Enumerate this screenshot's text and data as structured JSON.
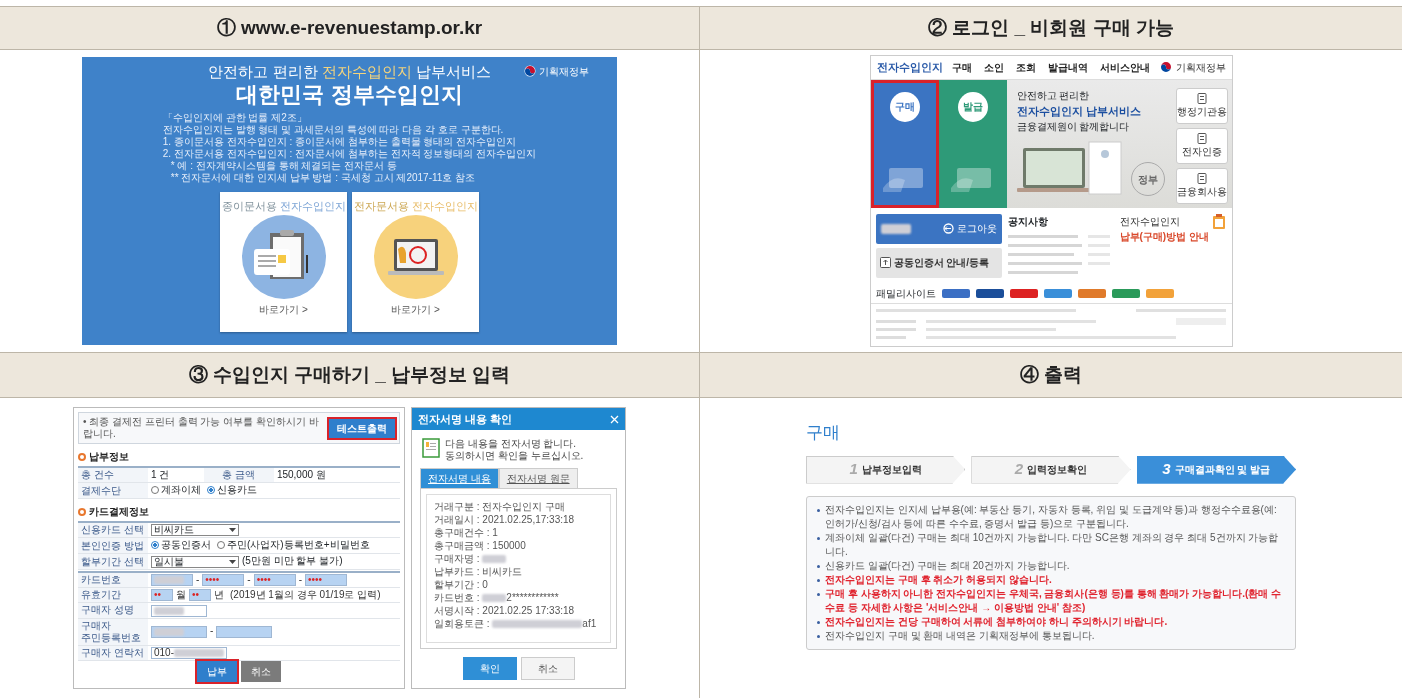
{
  "sections": [
    {
      "kind": "home",
      "heading": "① www.e-revenuestamp.or.kr",
      "screen": {
        "ministry": "기획재정부",
        "headline": {
          "lead": "안전하고 편리한",
          "accent": "전자수입인지",
          "tail": "납부서비스"
        },
        "title": "대한민국 정부수입인지",
        "law_lines": [
          {
            "text": "「수입인지에 관한 법률 제2조」",
            "indented": false
          },
          {
            "text": "전자수입인지는 발행 형태 및 과세문서의 특성에 따라 다음 각 호로 구분한다.",
            "indented": false
          },
          {
            "text": "1. 종이문서용 전자수입인지 : 종이문서에 첨부하는 출력물 형태의 전자수입인지",
            "indented": false
          },
          {
            "text": "2. 전자문서용 전자수입인지 : 전자문서에 첨부하는 전자적 정보형태의 전자수입인지",
            "indented": false
          },
          {
            "text": "* 예 : 전자계약시스템을 통해 체결되는 전자문서 등",
            "indented": true
          },
          {
            "text": "** 전자문서에 대한 인지세 납부 방법 : 국세청 고시 제2017-11호 참조",
            "indented": true
          }
        ],
        "cards": [
          {
            "color": "#8db4e2",
            "accent": "종이문서용",
            "name": "전자수입인지",
            "link": "바로가기 >"
          },
          {
            "color": "#f7d27c",
            "accent": "전자문서용",
            "name": "전자수입인지",
            "link": "바로가기 >"
          }
        ]
      }
    },
    {
      "kind": "portal",
      "heading": "② 로그인 _ 비회원 구매 가능",
      "screen": {
        "logo": "전자수입인지",
        "menu": [
          "구매",
          "소인",
          "조회",
          "발급내역",
          "서비스안내"
        ],
        "ministry": "기획재정부",
        "tiles": [
          {
            "label": "구매",
            "color": "#3b74c2",
            "highlighted": true
          },
          {
            "label": "발급",
            "color": "#2e9a78",
            "highlighted": false
          }
        ],
        "hero": [
          "안전하고 편리한",
          "전자수입인지 납부서비스",
          "금융결제원이 함께합니다"
        ],
        "seal": "정부",
        "quick_links": [
          "행정기관용",
          "전자인증",
          "금융회사용"
        ],
        "logout": "로그아웃",
        "cert": "공동인증서 안내/등록",
        "notice_title": "공지사항",
        "guide_lines": [
          "전자수입인지",
          "납부(구매)방법 안내"
        ],
        "family_site": "패밀리사이트"
      }
    },
    {
      "kind": "payment",
      "heading": "③ 수입인지 구매하기 _ 납부정보 입력",
      "form": {
        "notice": "• 최종 결제전 프린터 출력 가능 여부를 확인하시기 바랍니다.",
        "test_button": {
          "label": "테스트출력",
          "highlighted": true
        },
        "groups": [
          {
            "title": "납부정보",
            "rows": [
              {
                "kind": "pair",
                "label": "총 건수",
                "value": "1 건",
                "label_2": "총 금액",
                "value_2": "150,000 원"
              },
              {
                "kind": "radio",
                "label": "결제수단",
                "options": [
                  {
                    "label": "계좌이체",
                    "selected": false
                  },
                  {
                    "label": "신용카드",
                    "selected": true
                  }
                ]
              }
            ]
          },
          {
            "title": "카드결제정보",
            "rows": [
              {
                "kind": "select",
                "label": "신용카드 선택",
                "value": "비씨카드"
              },
              {
                "kind": "radio",
                "label": "본인인증 방법",
                "options": [
                  {
                    "label": "공동인증서",
                    "selected": true
                  },
                  {
                    "label": "주민(사업자)등록번호+비밀번호",
                    "selected": false
                  }
                ]
              },
              {
                "kind": "select",
                "label": "할부기간 선택",
                "value": "일시불",
                "note": "(5만원 미만 할부 불가)"
              }
            ]
          },
          {
            "rows": [
              {
                "kind": "inputs",
                "label": "카드번호",
                "parts": [
                  {
                    "kind": "field",
                    "redacted": true,
                    "autofilled": true
                  },
                  {
                    "kind": "text",
                    "text": "-"
                  },
                  {
                    "kind": "field",
                    "value": "••••",
                    "redacted": false,
                    "autofilled": true
                  },
                  {
                    "kind": "text",
                    "text": "-"
                  },
                  {
                    "kind": "field",
                    "value": "••••",
                    "redacted": false,
                    "autofilled": true
                  },
                  {
                    "kind": "text",
                    "text": "-"
                  },
                  {
                    "kind": "field",
                    "value": "••••",
                    "redacted": false,
                    "autofilled": true
                  }
                ]
              },
              {
                "kind": "inputs",
                "label": "유효기간",
                "parts": [
                  {
                    "kind": "field",
                    "value": "••",
                    "redacted": false,
                    "autofilled": true
                  },
                  {
                    "kind": "text",
                    "text": "월"
                  },
                  {
                    "kind": "field",
                    "value": "••",
                    "redacted": false,
                    "autofilled": true
                  },
                  {
                    "kind": "text",
                    "text": "년"
                  },
                  {
                    "kind": "text",
                    "text": "(2019년 1월의 경우 01/19로 입력)"
                  }
                ]
              },
              {
                "kind": "inputs",
                "label": "구매자 성명",
                "parts": [
                  {
                    "kind": "field",
                    "redacted": true,
                    "autofilled": false
                  }
                ]
              },
              {
                "kind": "inputs",
                "label": "구매자\n주민등록번호",
                "parts": [
                  {
                    "kind": "field",
                    "redacted": true,
                    "autofilled": true
                  },
                  {
                    "kind": "text",
                    "text": "-"
                  },
                  {
                    "kind": "field",
                    "redacted": false,
                    "autofilled": true
                  }
                ]
              },
              {
                "kind": "inputs",
                "label": "구매자 연락처",
                "parts": [
                  {
                    "kind": "field",
                    "value": "010-",
                    "redacted": true,
                    "autofilled": false
                  }
                ]
              }
            ]
          }
        ],
        "buttons": [
          {
            "label": "납부",
            "kind": "primary",
            "highlighted": true
          },
          {
            "label": "취소",
            "kind": "secondary",
            "highlighted": false
          }
        ]
      },
      "dialog": {
        "title": "전자서명 내용 확인",
        "message": [
          "다음 내용을 전자서명 합니다.",
          "동의하시면 확인을 누르십시오."
        ],
        "tabs": [
          {
            "label": "전자서명 내용",
            "selected": true
          },
          {
            "label": "전자서명 원문",
            "selected": false
          }
        ],
        "lines": [
          {
            "label": "거래구분 :",
            "value": "전자수입인지 구매",
            "redacted": false
          },
          {
            "label": "거래일시 :",
            "value": "2021.02.25,17:33:18",
            "redacted": false
          },
          {
            "label": "총구매건수 :",
            "value": "1",
            "redacted": false
          },
          {
            "label": "총구매금액 :",
            "value": "150000",
            "redacted": false
          },
          {
            "label": "구매자명 :",
            "redacted": true
          },
          {
            "label": "납부카드 :",
            "value": "비씨카드",
            "redacted": false
          },
          {
            "label": "할부기간 :",
            "value": "0",
            "redacted": false
          },
          {
            "label": "카드번호 :",
            "value": "2************",
            "redacted": true
          },
          {
            "label": "서명시작 :",
            "value": "2021.02.25 17:33:18",
            "redacted": false
          },
          {
            "label": "일회용토큰 :",
            "value": "af1",
            "redacted": true
          }
        ],
        "buttons": [
          {
            "label": "확인",
            "kind": "primary"
          },
          {
            "label": "취소",
            "kind": "secondary"
          }
        ]
      }
    },
    {
      "kind": "result",
      "heading": "④ 출력",
      "screen": {
        "title": "구매",
        "steps": [
          {
            "number": "1",
            "label": "납부정보입력",
            "selected": false
          },
          {
            "number": "2",
            "label": "입력정보확인",
            "selected": false
          },
          {
            "number": "3",
            "label": "구매결과확인 및 발급",
            "selected": true
          }
        ],
        "notes": [
          {
            "kind": "normal",
            "text": "전자수입인지는 인지세 납부용(예: 부동산 등기, 자동차 등록, 위임 및 도급계약 등)과 행정수수료용(예: 인허가/신청/검사 등에 따른 수수료, 증명서 발급 등)으로 구분됩니다."
          },
          {
            "kind": "normal",
            "text": "계좌이체 일괄(다건) 구매는 최대 10건까지 가능합니다. 다만 SC은행 계좌의 경우 최대 5건까지 가능합니다."
          },
          {
            "kind": "normal",
            "text": "신용카드 일괄(다건) 구매는 최대 20건까지 가능합니다."
          },
          {
            "kind": "warning",
            "text": "전자수입인지는 구매 후 취소가 허용되지 않습니다."
          },
          {
            "kind": "warning",
            "text": "구매 후 사용하지 아니한 전자수입인지는 우체국, 금융회사(은행 등)를 통해 환매가 가능합니다.(환매 수수료 등 자세한 사항은 '서비스안내 → 이용방법 안내' 참조)"
          },
          {
            "kind": "warning",
            "text": "전자수입인지는 건당 구매하여 서류에 첨부하여야 하니 주의하시기 바랍니다."
          },
          {
            "kind": "normal",
            "text": "전자수입인지 구매 및 환매 내역은 기획재정부에 통보됩니다."
          }
        ]
      }
    }
  ]
}
